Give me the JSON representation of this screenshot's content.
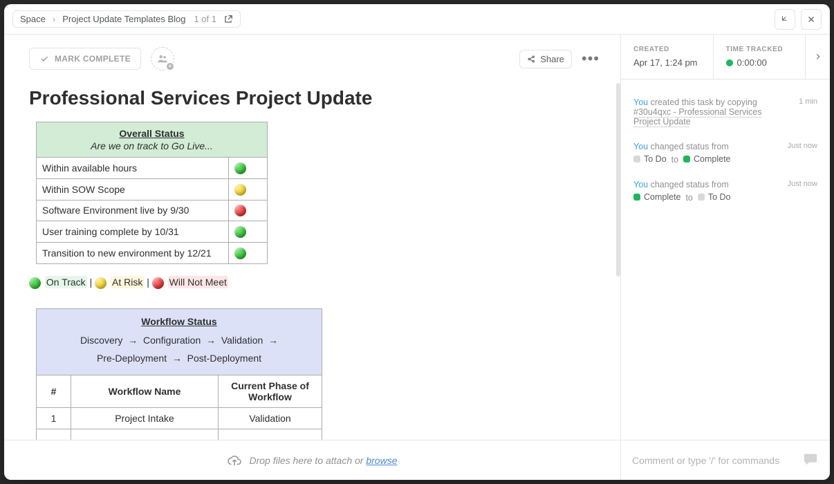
{
  "breadcrumb": {
    "root": "Space",
    "page": "Project Update Templates Blog",
    "count": "1 of 1"
  },
  "header": {
    "mark_complete": "MARK COMPLETE",
    "share": "Share"
  },
  "meta": {
    "created_label": "CREATED",
    "created_value": "Apr 17, 1:24 pm",
    "time_label": "TIME TRACKED",
    "time_value": "0:00:00"
  },
  "title": "Professional Services Project Update",
  "overall": {
    "heading": "Overall Status",
    "sub": "Are we on track to Go Live...",
    "rows": [
      {
        "label": "Within available hours",
        "color": "green"
      },
      {
        "label": "Within SOW Scope",
        "color": "yellow"
      },
      {
        "label": "Software Environment live by 9/30",
        "color": "red"
      },
      {
        "label": "User training complete by 10/31",
        "color": "green"
      },
      {
        "label": "Transition to new environment by 12/21",
        "color": "green"
      }
    ]
  },
  "legend": {
    "on_track": "On Track",
    "sep1": " | ",
    "at_risk": "At Risk",
    "sep2": " | ",
    "will_not": "Will Not Meet"
  },
  "workflow": {
    "heading": "Workflow Status",
    "flow": [
      "Discovery",
      "Configuration",
      "Validation",
      "Pre-Deployment",
      "Post-Deployment"
    ],
    "cols": {
      "num": "#",
      "name": "Workflow Name",
      "phase": "Current Phase of Workflow"
    },
    "rows": [
      {
        "num": "1",
        "name": "Project Intake",
        "phase": "Validation"
      }
    ]
  },
  "activity": {
    "items": [
      {
        "you": "You",
        "text": " created this task by copying ",
        "link": "#30u4qxc - Professional Services Project Update",
        "time": "1 min"
      },
      {
        "you": "You",
        "text": " changed status from",
        "from": {
          "label": "To Do",
          "color": "grey"
        },
        "to_word": "to",
        "to": {
          "label": "Complete",
          "color": "green"
        },
        "time": "Just now"
      },
      {
        "you": "You",
        "text": " changed status from",
        "from": {
          "label": "Complete",
          "color": "green"
        },
        "to_word": "to",
        "to": {
          "label": "To Do",
          "color": "grey"
        },
        "time": "Just now"
      }
    ]
  },
  "footer": {
    "drop_prefix": "Drop files here to attach or ",
    "browse": "browse",
    "comment_placeholder": "Comment or type '/' for commands"
  }
}
